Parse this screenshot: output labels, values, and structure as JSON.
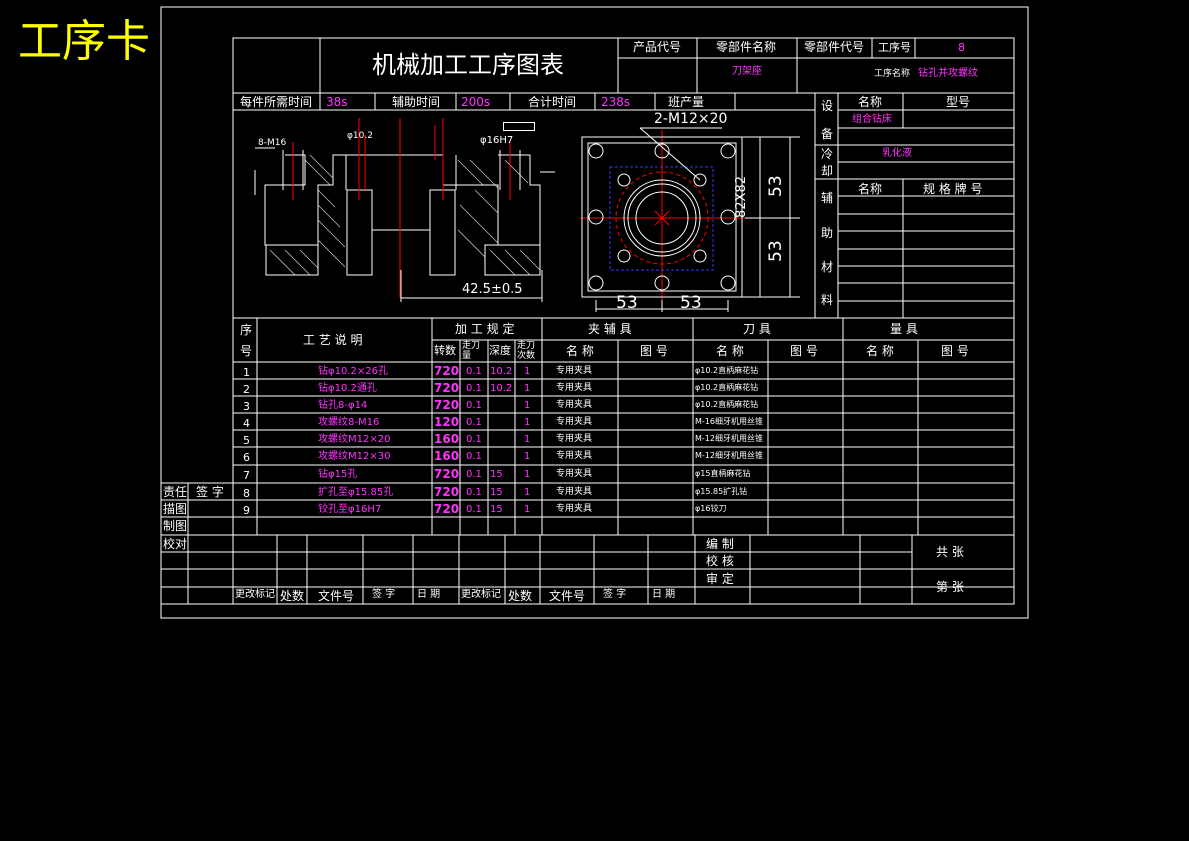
{
  "sheet_title": "工序卡",
  "header": {
    "main_title": "机械加工工序图表",
    "product_code_label": "产品代号",
    "part_name_label": "零部件名称",
    "part_code_label": "零部件代号",
    "op_no_label": "工序号",
    "op_no_value": "8",
    "part_name_value": "刀架座",
    "op_name_label": "工序名称",
    "op_name_value": "钻孔并攻螺纹"
  },
  "time_row": {
    "per_piece_label": "每件所需时间",
    "per_piece_value": "38s",
    "aux_label": "辅助时间",
    "aux_value": "200s",
    "total_label": "合计时间",
    "total_value": "238s",
    "shift_label": "班产量"
  },
  "equipment": {
    "equip_chars": [
      "设",
      "备"
    ],
    "cool_chars": [
      "冷",
      "却"
    ],
    "aux_chars": [
      "辅",
      "助",
      "材",
      "料"
    ],
    "name_label": "名称",
    "model_label": "型号",
    "machine_value": "组合钻床",
    "coolant_value": "乳化液",
    "spec_label": "规 格 牌 号"
  },
  "drawing": {
    "left_labels": [
      "8-M16",
      "φ10.2",
      "φ16H7",
      "42.5±0.5"
    ],
    "right_labels": [
      "2-M12×20",
      "82X82",
      "53",
      "53",
      "53",
      "53"
    ]
  },
  "table": {
    "seq_chars": [
      "序",
      "号"
    ],
    "process_desc": "工  艺  说  明",
    "machining_spec": "加 工 规 定",
    "fixture": "夹    辅    具",
    "tool": "刀          具",
    "gauge": "量          具",
    "sub_headers": [
      "转数",
      "走刀量",
      "深度",
      "走刀次数"
    ],
    "name": "名  称",
    "drawing_no": "图  号",
    "rows": [
      {
        "no": "1",
        "desc": "钻φ10.2×26孔",
        "rpm": "720",
        "feed": "0.1",
        "depth": "10.2",
        "passes": "1",
        "fixture": "专用夹具",
        "tool": "φ10.2直柄麻花钻"
      },
      {
        "no": "2",
        "desc": "钻φ10.2通孔",
        "rpm": "720",
        "feed": "0.1",
        "depth": "10.2",
        "passes": "1",
        "fixture": "专用夹具",
        "tool": "φ10.2直柄麻花钻"
      },
      {
        "no": "3",
        "desc": "钻孔8-φ14",
        "rpm": "720",
        "feed": "0.1",
        "depth": "",
        "passes": "1",
        "fixture": "专用夹具",
        "tool": "φ10.2直柄麻花钻"
      },
      {
        "no": "4",
        "desc": "攻螺纹8-M16",
        "rpm": "120",
        "feed": "0.1",
        "depth": "",
        "passes": "1",
        "fixture": "专用夹具",
        "tool": "M-16细牙机用丝锥"
      },
      {
        "no": "5",
        "desc": "攻螺纹M12×20",
        "rpm": "160",
        "feed": "0.1",
        "depth": "",
        "passes": "1",
        "fixture": "专用夹具",
        "tool": "M-12细牙机用丝锥"
      },
      {
        "no": "6",
        "desc": "攻螺纹M12×30",
        "rpm": "160",
        "feed": "0.1",
        "depth": "",
        "passes": "1",
        "fixture": "专用夹具",
        "tool": "M-12细牙机用丝锥"
      },
      {
        "no": "7",
        "desc": "钻φ15孔",
        "rpm": "720",
        "feed": "0.1",
        "depth": "15",
        "passes": "1",
        "fixture": "专用夹具",
        "tool": "φ15直柄麻花钻"
      },
      {
        "no": "8",
        "desc": "扩孔至φ15.85孔",
        "rpm": "720",
        "feed": "0.1",
        "depth": "15",
        "passes": "1",
        "fixture": "专用夹具",
        "tool": "φ15.85扩孔钻"
      },
      {
        "no": "9",
        "desc": "铰孔至φ16H7",
        "rpm": "720",
        "feed": "0.1",
        "depth": "15",
        "passes": "1",
        "fixture": "专用夹具",
        "tool": "φ16铰刀"
      }
    ]
  },
  "side_labels": {
    "responsible": "责任",
    "sign": "签  字",
    "trace": "描图",
    "draw": "制图",
    "check": "校对"
  },
  "footer": {
    "compile": "编  制",
    "review": "校  核",
    "approve": "审  定",
    "total_sheets": "共      张",
    "sheet_no": "第      张",
    "cols": [
      "更改标记",
      "处数",
      "文件号",
      "签  字",
      "日  期",
      "更改标记",
      "处数",
      "文件号",
      "签  字",
      "日  期"
    ]
  },
  "colors": {
    "line": "#ffffff",
    "magenta": "#ff33ff",
    "yellow": "#ffff00",
    "red": "#ff0000",
    "blue": "#3333ff"
  }
}
